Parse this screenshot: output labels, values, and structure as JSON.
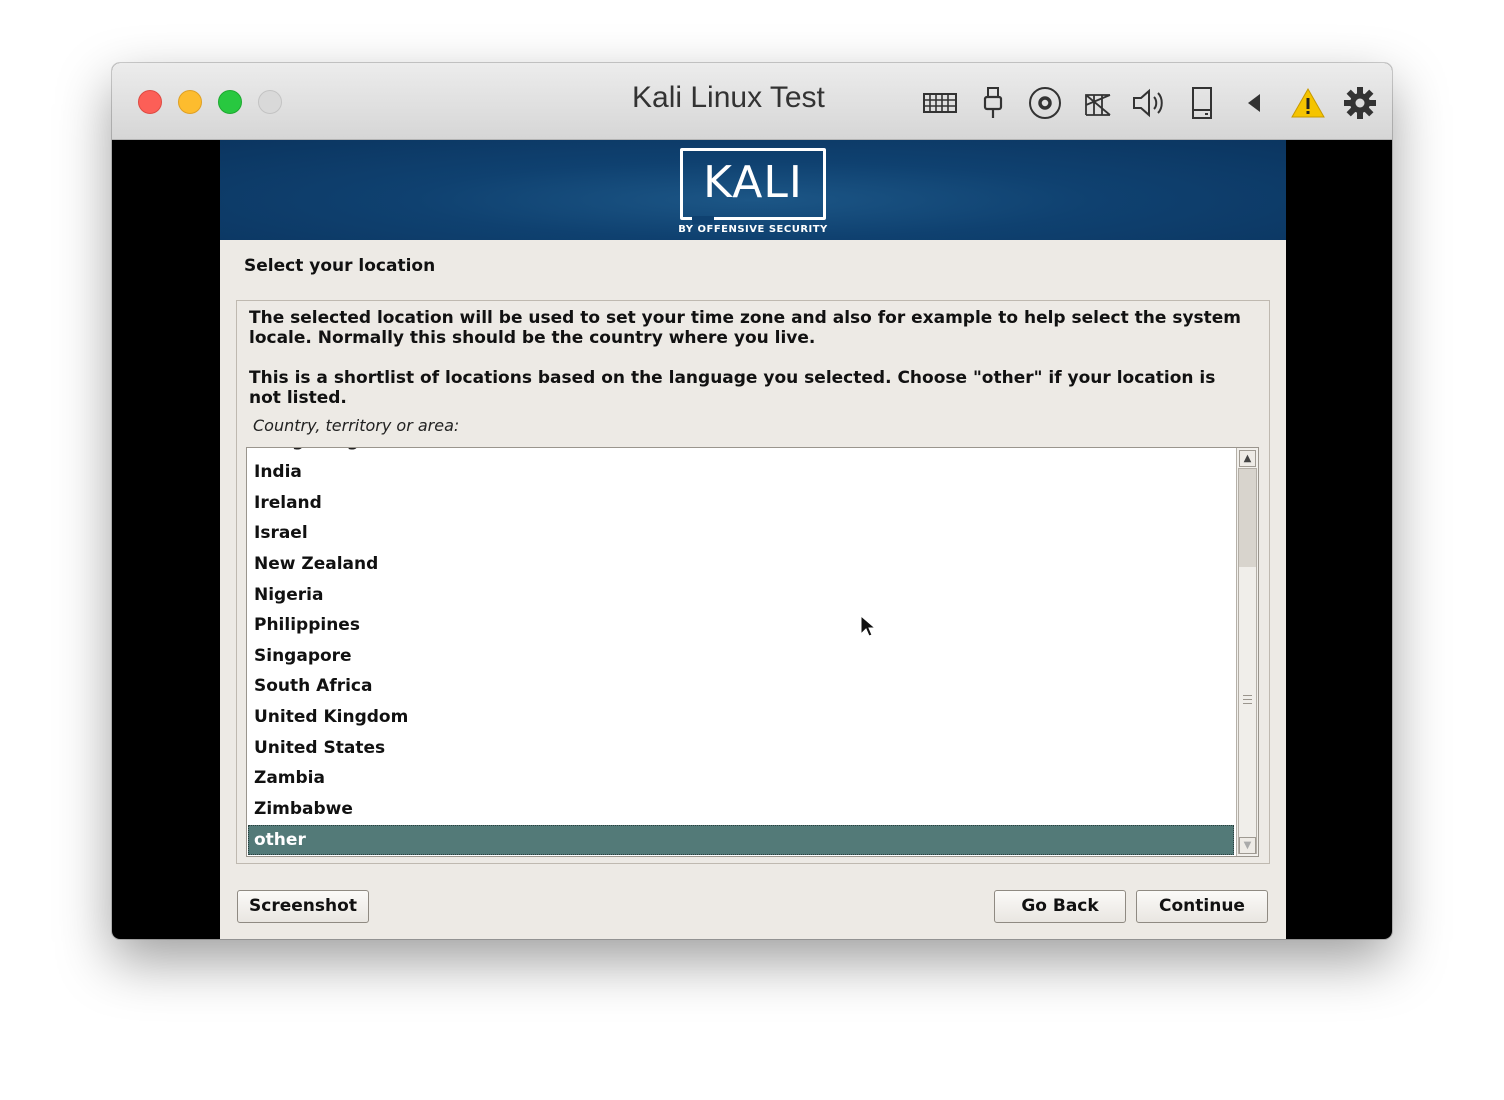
{
  "window": {
    "title": "Kali Linux Test",
    "toolbar_icons": [
      "keyboard-icon",
      "usb-icon",
      "optical-disc-icon",
      "network-icon",
      "sound-icon",
      "hard-disk-icon",
      "back-arrow-icon",
      "warning-icon",
      "settings-gear-icon"
    ]
  },
  "banner": {
    "logo_text": "KALI",
    "logo_subtitle": "BY OFFENSIVE SECURITY"
  },
  "installer": {
    "heading": "Select your location",
    "description_1": "The selected location will be used to set your time zone and also for example to help select the system locale. Normally this should be the country where you live.",
    "description_2": "This is a shortlist of locations based on the language you selected. Choose \"other\" if your location is not listed.",
    "field_label": "Country, territory or area:",
    "countries": [
      "Hong Kong",
      "India",
      "Ireland",
      "Israel",
      "New Zealand",
      "Nigeria",
      "Philippines",
      "Singapore",
      "South Africa",
      "United Kingdom",
      "United States",
      "Zambia",
      "Zimbabwe",
      "other"
    ],
    "selected": "other",
    "buttons": {
      "screenshot": "Screenshot",
      "go_back": "Go Back",
      "continue": "Continue"
    }
  },
  "colors": {
    "banner_blue": "#0f4170",
    "selection": "#537a78",
    "warning": "#f5c400"
  }
}
